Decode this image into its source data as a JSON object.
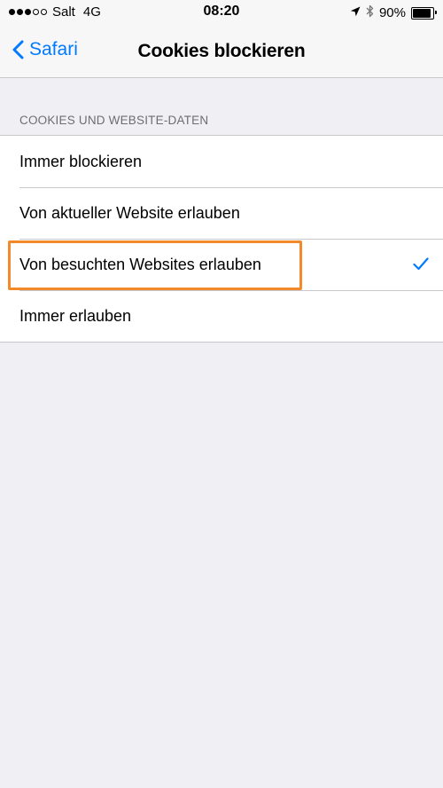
{
  "status_bar": {
    "carrier": "Salt",
    "network": "4G",
    "time": "08:20",
    "battery": "90%",
    "battery_level": 0.9,
    "signal_filled": 3,
    "signal_total": 5,
    "icons": [
      "location-arrow-icon",
      "bluetooth-icon",
      "battery-icon"
    ]
  },
  "nav": {
    "back_label": "Safari",
    "title": "Cookies blockieren"
  },
  "section": {
    "header": "COOKIES UND WEBSITE-DATEN",
    "options": [
      {
        "label": "Immer blockieren",
        "selected": false
      },
      {
        "label": "Von aktueller Website erlauben",
        "selected": false
      },
      {
        "label": "Von besuchten Websites erlauben",
        "selected": true
      },
      {
        "label": "Immer erlauben",
        "selected": false
      }
    ]
  },
  "colors": {
    "accent": "#007aff",
    "highlight": "#f28a2c",
    "background": "#efeff4"
  }
}
